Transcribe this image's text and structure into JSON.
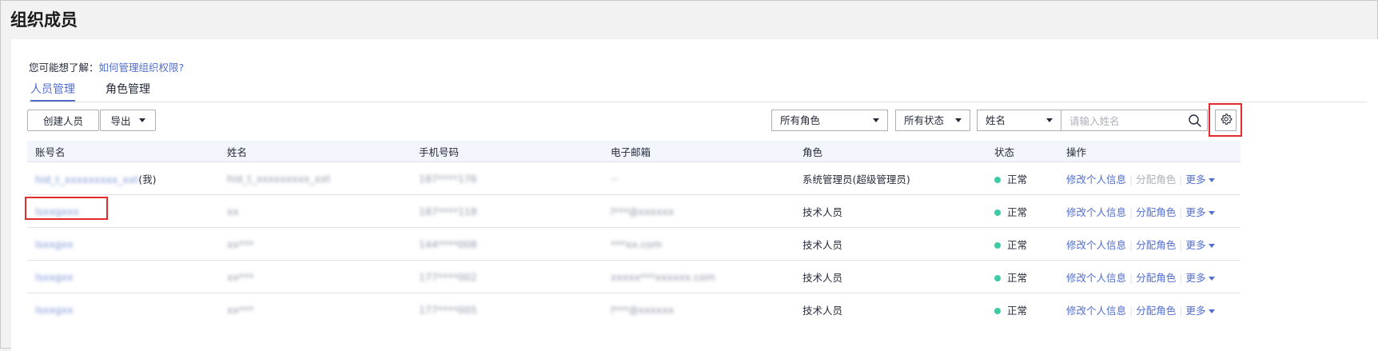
{
  "page_title": "组织成员",
  "hint": {
    "prefix": "您可能想了解：",
    "link": "如何管理组织权限?"
  },
  "tabs": [
    {
      "label": "人员管理"
    },
    {
      "label": "角色管理"
    }
  ],
  "toolbar": {
    "create_label": "创建人员",
    "export_label": "导出"
  },
  "filters": {
    "role": "所有角色",
    "status": "所有状态",
    "field": "姓名",
    "search_placeholder": "请输入姓名"
  },
  "table": {
    "columns": [
      "账号名",
      "姓名",
      "手机号码",
      "电子邮箱",
      "角色",
      "状态",
      "操作"
    ],
    "rows": [
      {
        "account": "hid_t_xxxxxxxxx_xxt",
        "self_tag": "(我)",
        "name": "hid_t_xxxxxxxxx_xxt",
        "phone": "187****176",
        "email": "--",
        "role": "系统管理员(超级管理员)",
        "status": "正常"
      },
      {
        "account": "lsxxgxxx",
        "self_tag": "",
        "name": "xx",
        "phone": "187****118",
        "email": "l***@xxxxxx",
        "role": "技术人员",
        "status": "正常"
      },
      {
        "account": "lsxxgxx",
        "self_tag": "",
        "name": "xx***",
        "phone": "144****008",
        "email": "***xx.com",
        "role": "技术人员",
        "status": "正常"
      },
      {
        "account": "lsxxgxx",
        "self_tag": "",
        "name": "xx***",
        "phone": "177****002",
        "email": "xxxxx***xxxxxx.com",
        "role": "技术人员",
        "status": "正常"
      },
      {
        "account": "lsxxgxx",
        "self_tag": "",
        "name": "xx***",
        "phone": "177****005",
        "email": "l***@xxxxxx",
        "role": "技术人员",
        "status": "正常"
      }
    ],
    "ops": {
      "edit": "修改个人信息",
      "assign": "分配角色",
      "more": "更多"
    }
  }
}
